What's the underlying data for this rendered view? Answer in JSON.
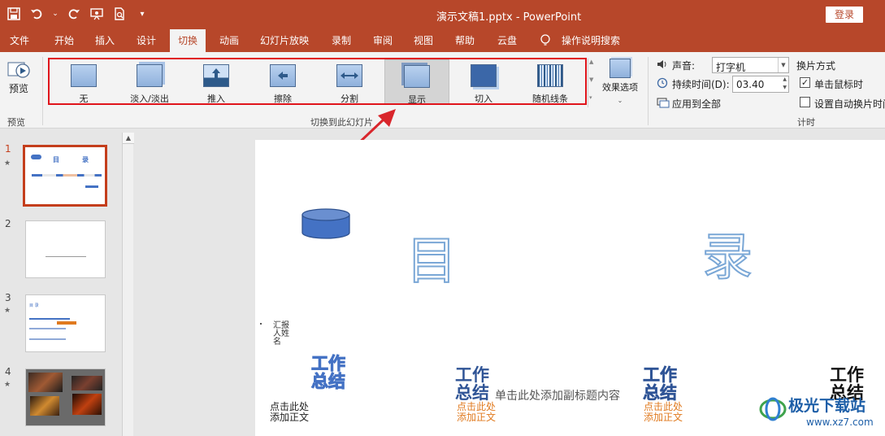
{
  "titlebar": {
    "title": "演示文稿1.pptx - PowerPoint",
    "login": "登录",
    "qat_icons": [
      "save-icon",
      "undo-icon",
      "redo-icon",
      "slideshow-icon",
      "preview-icon",
      "customize-icon"
    ]
  },
  "menu": {
    "items": [
      "文件",
      "开始",
      "插入",
      "设计",
      "切换",
      "动画",
      "幻灯片放映",
      "录制",
      "审阅",
      "视图",
      "帮助",
      "云盘",
      "操作说明搜索"
    ],
    "active": "切换"
  },
  "ribbon": {
    "preview": {
      "label": "预览",
      "group": "预览"
    },
    "transitions": [
      {
        "label": "无"
      },
      {
        "label": "淡入/淡出"
      },
      {
        "label": "推入"
      },
      {
        "label": "擦除"
      },
      {
        "label": "分割"
      },
      {
        "label": "显示",
        "selected": true
      },
      {
        "label": "切入"
      },
      {
        "label": "随机线条"
      }
    ],
    "effect_options": "效果选项",
    "group_transitions": "切换到此幻灯片",
    "timing": {
      "sound_label": "声音:",
      "sound_value": "打字机",
      "duration_label": "持续时间(D):",
      "duration_value": "03.40",
      "apply_all": "应用到全部",
      "advance_title": "换片方式",
      "on_click": "单击鼠标时",
      "on_click_checked": true,
      "auto_after": "设置自动换片时间",
      "auto_after_checked": false,
      "group": "计时"
    }
  },
  "slides": [
    {
      "num": "1",
      "star": "★"
    },
    {
      "num": "2",
      "star": ""
    },
    {
      "num": "3",
      "star": "★"
    },
    {
      "num": "4",
      "star": "★"
    }
  ],
  "slide1_thumb": {
    "a": "目",
    "b": "录"
  },
  "slide3_thumb": {
    "title": "目 录"
  },
  "slide": {
    "char1": "目",
    "char2": "录",
    "reporter": "汇报人姓名",
    "block_title_1": "工作",
    "block_title_2": "总结",
    "click_add_1": "点击此处",
    "click_add_2": "添加正文",
    "subtitle": "单击此处添加副标题内容"
  },
  "colors": {
    "brand": "#b7472a",
    "highlight": "#e0141b",
    "arrow": "#d9262c",
    "stroke_blue": "#4472c4",
    "orange": "#e07a1f"
  },
  "watermark": {
    "line1": "极光下载站",
    "line2": "www.xz7.com"
  }
}
